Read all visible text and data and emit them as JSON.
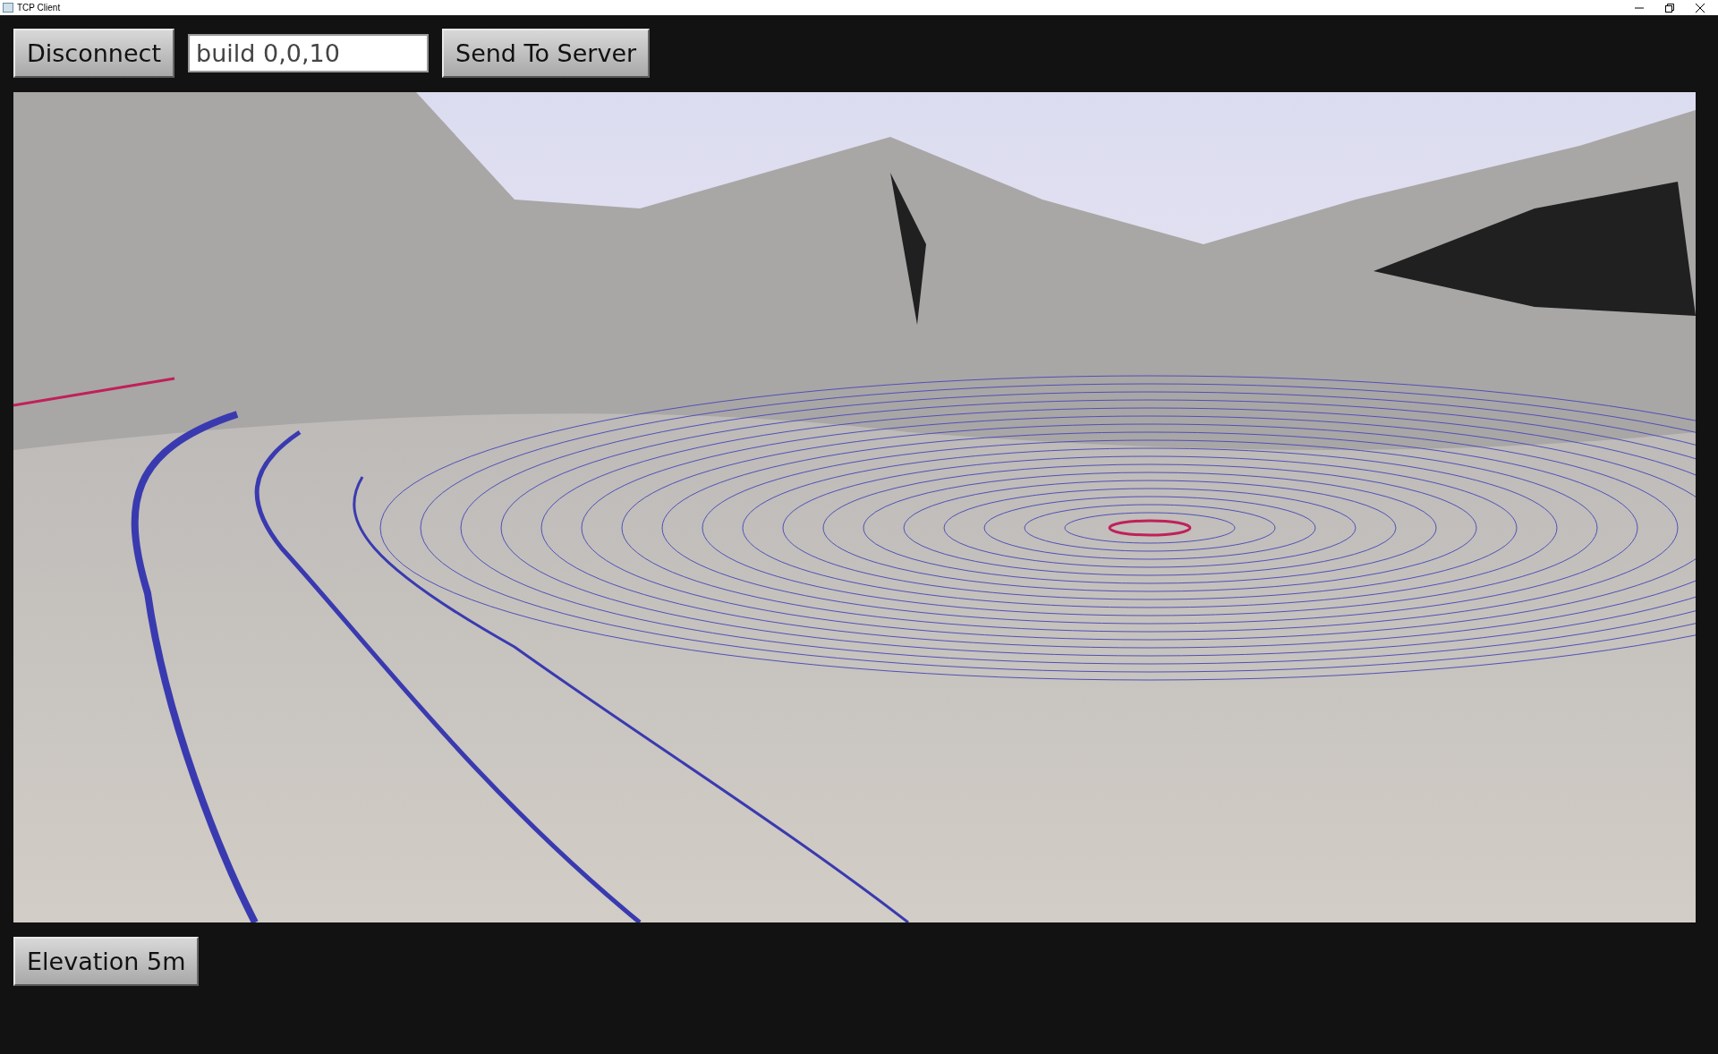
{
  "window": {
    "title": "TCP Client"
  },
  "toolbar": {
    "disconnect_button": "Disconnect",
    "command_field": {
      "value": "build 0,0,10"
    },
    "send_button": "Send To Server"
  },
  "status_button": "Elevation 5m"
}
